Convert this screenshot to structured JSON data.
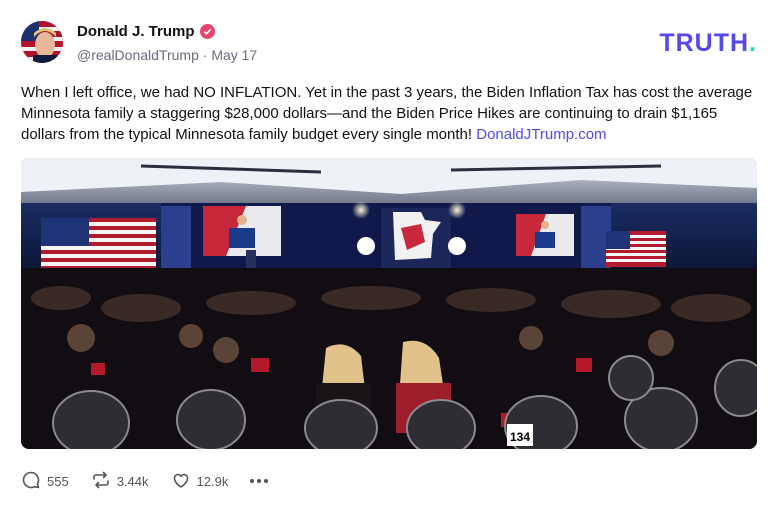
{
  "author": {
    "display_name": "Donald J. Trump",
    "handle": "@realDonaldTrump",
    "separator": "·",
    "date": "May 17"
  },
  "brand": {
    "logo_text": "TRUTH",
    "logo_dot": ".",
    "accent_color": "#5448ee",
    "dot_color": "#23d3c2"
  },
  "post": {
    "text": "When I left office, we had NO INFLATION. Yet in the past 3 years, the Biden Inflation Tax has cost the average Minnesota family a staggering $28,000 dollars—and the Biden Price Hikes are continuing to drain $1,165 dollars from the typical Minnesota family budget every single month!",
    "link_text": "DonaldJTrump.com"
  },
  "media": {
    "table_number": "134"
  },
  "actions": {
    "replies": "555",
    "retruths": "3.44k",
    "likes": "12.9k"
  },
  "icons": [
    "verified-badge-icon",
    "reply-icon",
    "retruth-icon",
    "like-icon",
    "more-icon"
  ]
}
